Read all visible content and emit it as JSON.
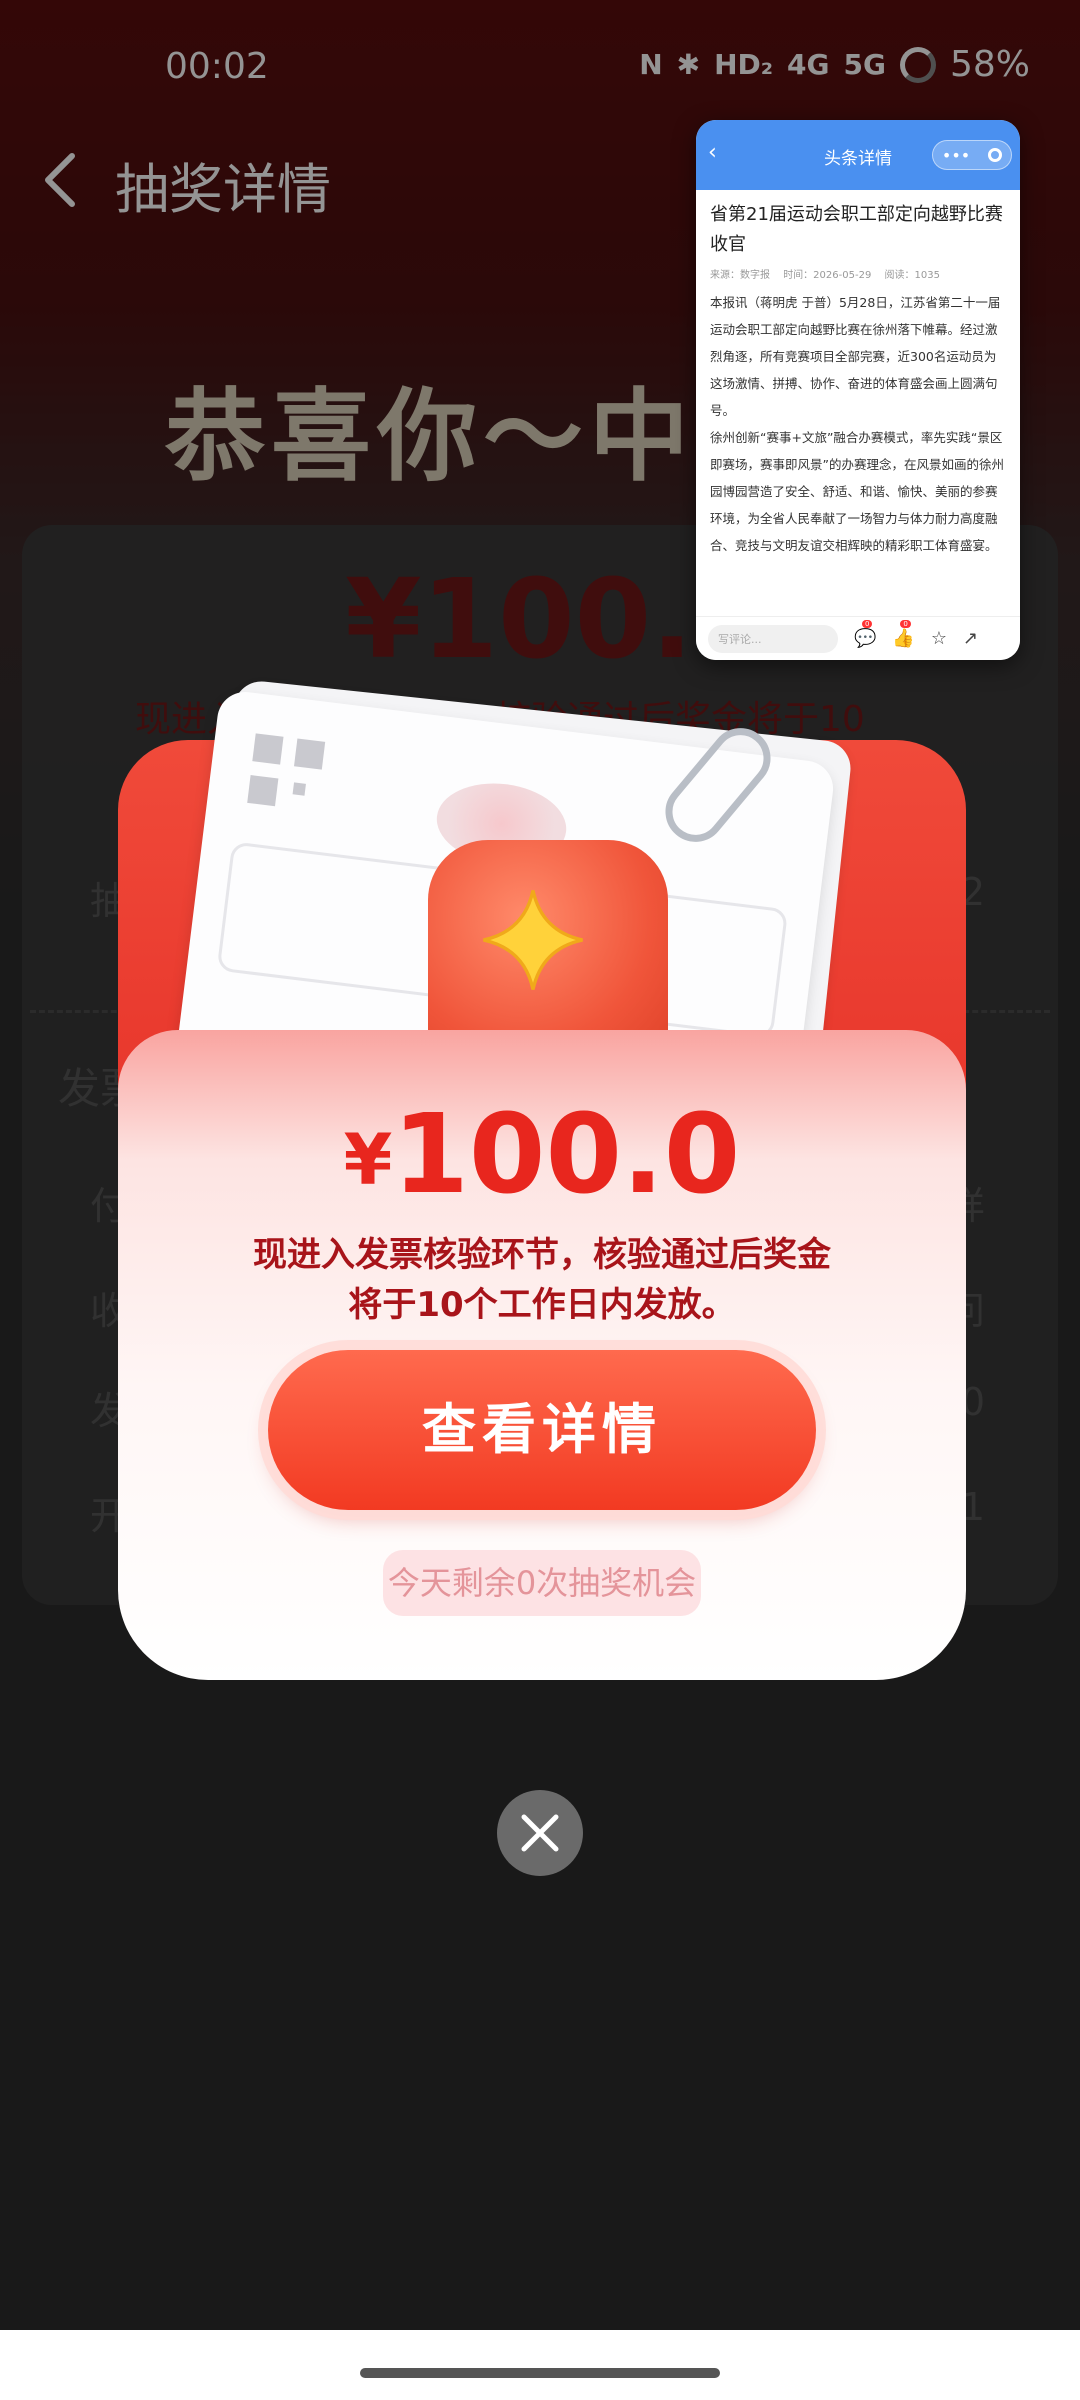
{
  "status_bar": {
    "time": "00:02",
    "nfc": "N",
    "bluetooth": "✱",
    "hd": "HD₂",
    "net1": "4G",
    "net2": "5G",
    "battery": "58%"
  },
  "header": {
    "title": "抽奖详情"
  },
  "background": {
    "congrats": "恭喜你～中奖",
    "amount": "¥100.00",
    "note": "现进入发票核验环节，核验通过后奖金将于10",
    "row_label_1": "抽",
    "row_value_1": "2",
    "section_label": "发票",
    "rows": [
      {
        "label": "付",
        "value": "详"
      },
      {
        "label": "收",
        "value": "问"
      },
      {
        "label": "发",
        "value": "0"
      },
      {
        "label": "开",
        "value": "1"
      }
    ]
  },
  "mini_window": {
    "header_title": "头条详情",
    "article_title": "省第21届运动会职工部定向越野比赛收官",
    "meta_source": "来源：数字报",
    "meta_time": "时间：2026-05-29",
    "meta_views": "阅读：1035",
    "para1": "本报讯（蒋明虎 于普）5月28日，江苏省第二十一届运动会职工部定向越野比赛在徐州落下帷幕。经过激烈角逐，所有竞赛项目全部完赛，近300名运动员为这场激情、拼搏、协作、奋进的体育盛会画上圆满句号。",
    "para2": "徐州创新“赛事+文旅”融合办赛模式，率先实践“景区即赛场，赛事即风景”的办赛理念，在风景如画的徐州园博园营造了安全、舒适、和谐、愉快、美丽的参赛环境，为全省人民奉献了一场智力与体力耐力高度融合、竞技与文明友谊交相辉映的精彩职工体育盛宴。",
    "comment_placeholder": "写评论...",
    "comment_badge": "0",
    "like_badge": "0"
  },
  "popup": {
    "currency": "¥",
    "amount": "100.0",
    "note": "现进入发票核验环节，核验通过后奖金将于10个工作日内发放。",
    "button_label": "查看详情",
    "remaining": "今天剩余0次抽奖机会"
  },
  "colors": {
    "prize_red": "#e8261e",
    "button_red": "#f23a22",
    "mini_header_blue": "#4a90f0"
  }
}
